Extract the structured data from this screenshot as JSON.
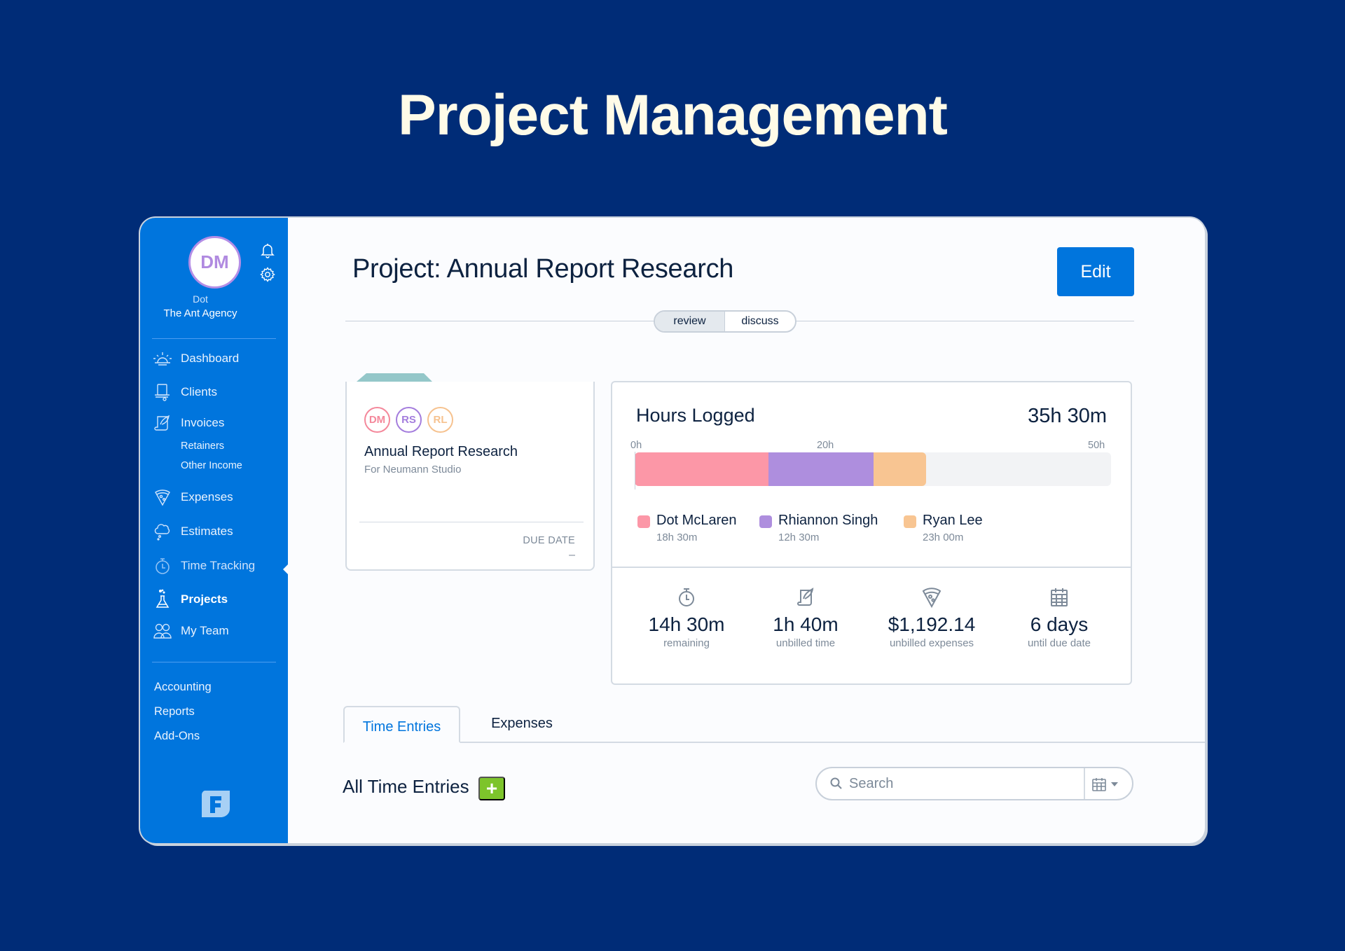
{
  "hero": {
    "title": "Project Management"
  },
  "sidebar": {
    "avatar_initials": "DM",
    "user_name": "Dot",
    "org_name": "The Ant Agency",
    "nav": [
      {
        "label": "Dashboard",
        "icon": "sunrise-icon"
      },
      {
        "label": "Clients",
        "icon": "top-hat-icon"
      },
      {
        "label": "Invoices",
        "icon": "scroll-quill-icon"
      },
      {
        "label": "Expenses",
        "icon": "pizza-slice-icon"
      },
      {
        "label": "Estimates",
        "icon": "thought-cloud-icon"
      },
      {
        "label": "Time Tracking",
        "icon": "stopwatch-icon"
      },
      {
        "label": "Projects",
        "icon": "flask-icon"
      },
      {
        "label": "My Team",
        "icon": "team-icon"
      }
    ],
    "invoice_subitems": [
      "Retainers",
      "Other Income"
    ],
    "secondary": [
      "Accounting",
      "Reports",
      "Add-Ons"
    ],
    "active_item": "Projects",
    "current_indicator": "Time Tracking"
  },
  "header": {
    "title": "Project: Annual Report Research",
    "edit_label": "Edit",
    "toggle": [
      "review",
      "discuss"
    ],
    "toggle_selected": "review"
  },
  "project_card": {
    "members": [
      {
        "initials": "DM",
        "color": "#f4889b"
      },
      {
        "initials": "RS",
        "color": "#a47ddd"
      },
      {
        "initials": "RL",
        "color": "#f6c28f"
      }
    ],
    "name": "Annual Report Research",
    "client": "For Neumann Studio",
    "due_label": "DUE DATE",
    "due_value": "–",
    "tab_color": "#94c7c9"
  },
  "hours": {
    "title": "Hours Logged",
    "total": "35h 30m",
    "ticks": [
      "0h",
      "20h",
      "50h"
    ],
    "segments": [
      {
        "name": "Dot McLaren",
        "hours": "18h 30m",
        "color": "#fc97a7",
        "fraction": 0.281
      },
      {
        "name": "Rhiannon Singh",
        "hours": "12h 30m",
        "color": "#ae8ede",
        "fraction": 0.221
      },
      {
        "name": "Ryan Lee",
        "hours": "23h 00m",
        "color": "#f8c592",
        "fraction": 0.11
      }
    ],
    "stats": [
      {
        "icon": "stopwatch-icon",
        "value": "14h 30m",
        "label": "remaining"
      },
      {
        "icon": "scroll-quill-icon",
        "value": "1h 40m",
        "label": "unbilled time"
      },
      {
        "icon": "pizza-slice-icon",
        "value": "$1,192.14",
        "label": "unbilled expenses"
      },
      {
        "icon": "calendar-icon",
        "value": "6 days",
        "label": "until due date"
      }
    ]
  },
  "tabs": [
    {
      "label": "Time Entries",
      "active": true
    },
    {
      "label": "Expenses",
      "active": false
    }
  ],
  "entries": {
    "title": "All Time Entries",
    "add_label": "+",
    "search_placeholder": "Search",
    "search_value": ""
  },
  "colors": {
    "background": "#002c77",
    "sidebar": "#0075dd",
    "accent": "#0075dd",
    "add_green": "#7dc42b",
    "hero_text": "#fffbe8"
  }
}
